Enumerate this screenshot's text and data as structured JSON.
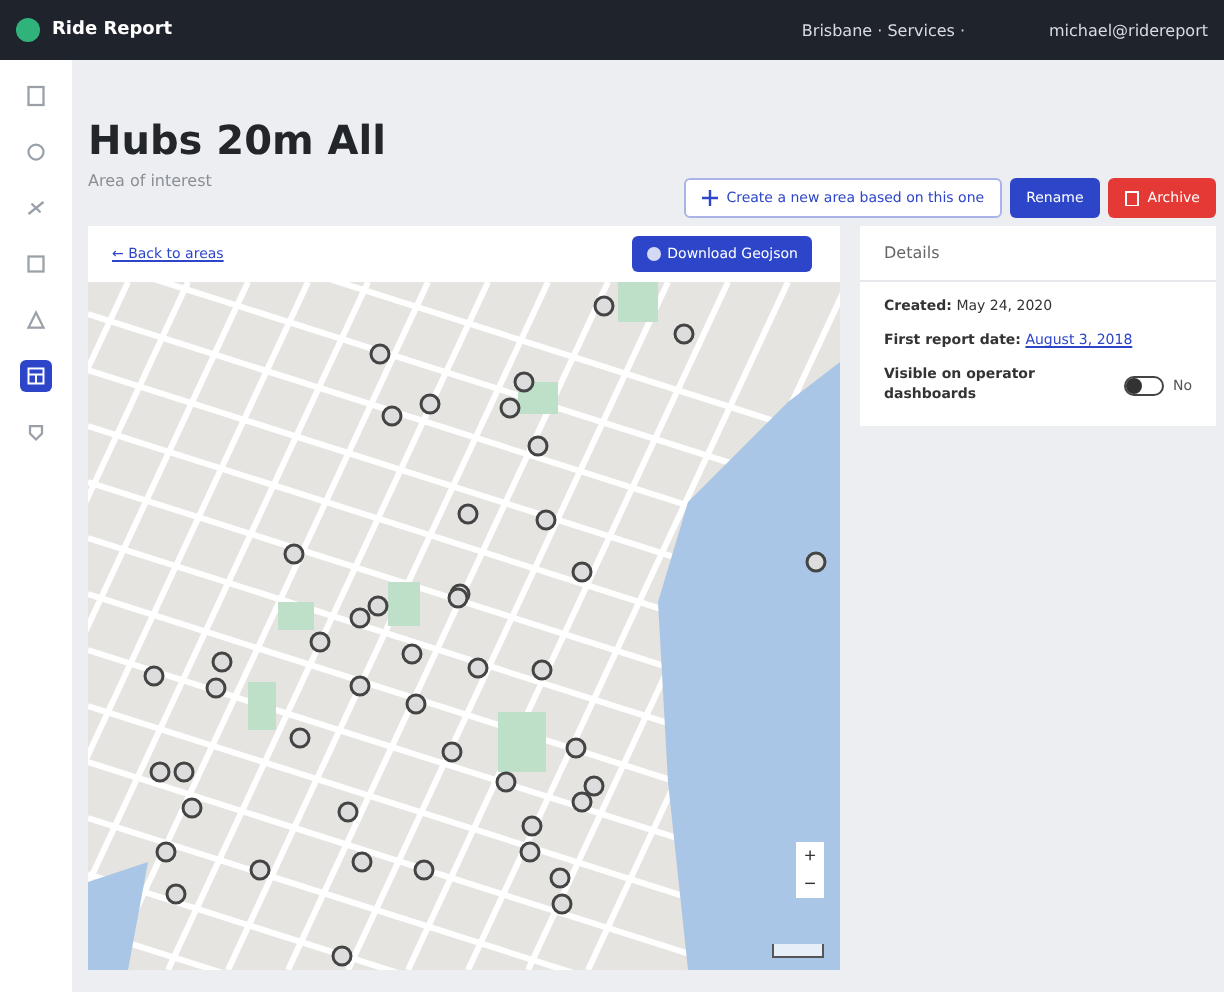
{
  "topbar": {
    "brand": "Ride Report",
    "region": "Brisbane · Services ·",
    "user": "michael@ridereport"
  },
  "sidebar": {
    "items": [
      {
        "selected": false
      },
      {
        "selected": false
      },
      {
        "selected": false
      },
      {
        "selected": false
      },
      {
        "selected": false
      },
      {
        "selected": true
      },
      {
        "selected": false
      }
    ]
  },
  "header": {
    "title": "Hubs 20m All",
    "subtitle": "Area of interest",
    "buttons": [
      {
        "kind": "outline",
        "label": "Create a new area based on this one"
      },
      {
        "kind": "primary",
        "label": "Rename"
      },
      {
        "kind": "danger",
        "label": "Archive"
      }
    ]
  },
  "map_card": {
    "back_link": "← Back to areas",
    "download": "Download Geojson",
    "zoom_in": "+",
    "zoom_out": "−"
  },
  "details": {
    "title": "Details",
    "created_label": "Created:",
    "created_value": "May 24, 2020",
    "first_report_label": "First report date:",
    "first_report_value": "August 3, 2018",
    "visible_label": "Visible on operator dashboards",
    "visible": {
      "on": false,
      "text": "No"
    }
  }
}
